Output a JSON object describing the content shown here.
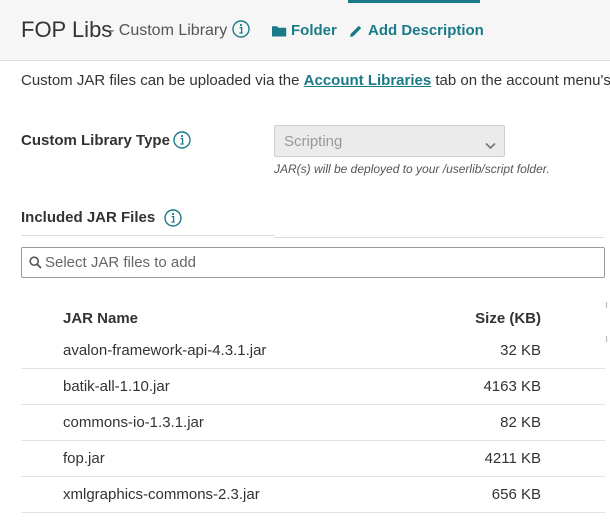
{
  "header": {
    "title": "FOP Libs",
    "subtitle": "- Custom Library",
    "folder_link": "Folder",
    "add_description_link": "Add Description"
  },
  "intro": {
    "text_before": "Custom JAR files can be uploaded via the ",
    "link": "Account Libraries",
    "text_after": " tab on the account menu's Se"
  },
  "library_type": {
    "label": "Custom Library Type",
    "selected": "Scripting",
    "hint": "JAR(s) will be deployed to your /userlib/script folder."
  },
  "jar_section": {
    "title": "Included JAR Files",
    "search_placeholder": "Select JAR files to add"
  },
  "table": {
    "columns": [
      "JAR Name",
      "Size (KB)"
    ],
    "rows": [
      {
        "name": "avalon-framework-api-4.3.1.jar",
        "size": "32 KB"
      },
      {
        "name": "batik-all-1.10.jar",
        "size": "4163 KB"
      },
      {
        "name": "commons-io-1.3.1.jar",
        "size": "82 KB"
      },
      {
        "name": "fop.jar",
        "size": "4211 KB"
      },
      {
        "name": "xmlgraphics-commons-2.3.jar",
        "size": "656 KB"
      }
    ]
  },
  "colors": {
    "accent": "#1b7a89",
    "header_bg": "#f6f6f6",
    "text": "#333333"
  },
  "icons": {
    "info": "info-circle-icon",
    "folder": "folder-icon",
    "pencil": "pencil-icon",
    "search": "search-icon",
    "chevron": "chevron-down-icon"
  }
}
